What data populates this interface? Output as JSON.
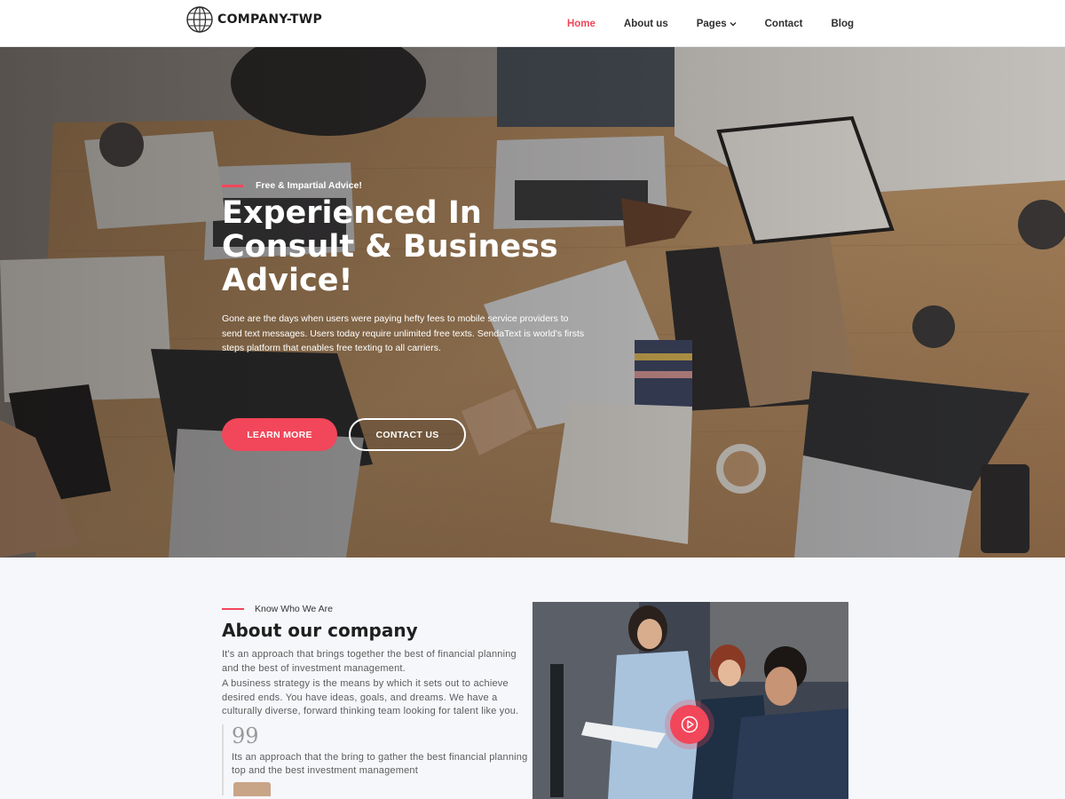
{
  "header": {
    "logo_text": "COMPANY-TWP",
    "nav": [
      {
        "label": "Home",
        "active": true
      },
      {
        "label": "About us"
      },
      {
        "label": "Pages",
        "has_dropdown": true
      },
      {
        "label": "Contact"
      },
      {
        "label": "Blog"
      }
    ]
  },
  "hero": {
    "tagline": "Free & Impartial Advice!",
    "title": "Experienced In Consult & Business Advice!",
    "description": "Gone are the days when users were paying hefty fees to mobile service providers to send text messages. Users today require unlimited free texts. SendaText is world's firsts steps platform that enables free texting to all carriers.",
    "primary_button": "LEARN MORE",
    "secondary_button": "CONTACT US"
  },
  "about": {
    "eyebrow": "Know Who We Are",
    "title": "About our company",
    "paragraph1": "It's an approach that brings together the best of financial planning and the best of investment management.",
    "paragraph2": "A business strategy is the means by which it sets out to achieve desired ends. You have ideas, goals, and dreams. We have a culturally diverse, forward thinking team looking for talent like you.",
    "quote_mark": "99",
    "quote": "Its an approach that the bring to gather the best financial planning top and the best investment management"
  },
  "colors": {
    "accent": "#f2465a",
    "text_dark": "#1f1f1f",
    "text_body": "#5c5c5c",
    "section_bg": "#f5f7fa"
  },
  "icons": {
    "logo": "globe-icon",
    "dropdown": "chevron-down-icon",
    "video": "play-icon"
  }
}
